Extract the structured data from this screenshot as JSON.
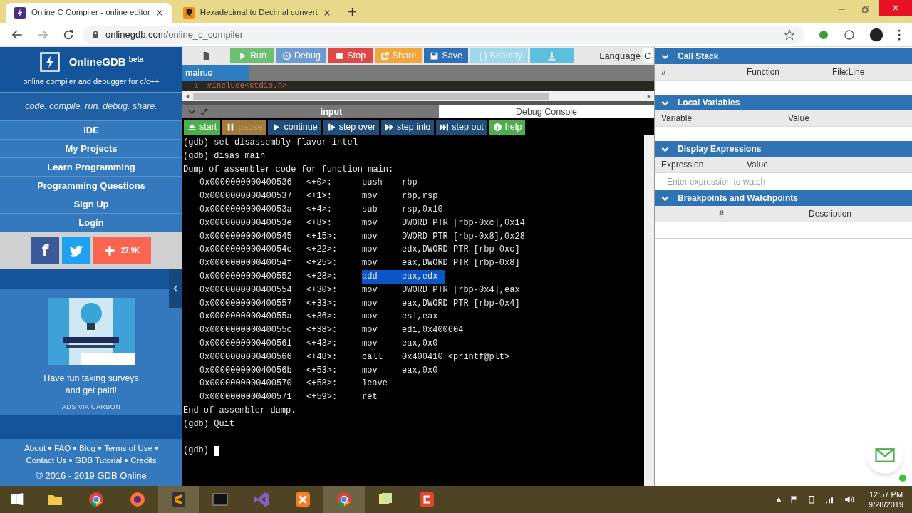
{
  "browser": {
    "tabs": [
      {
        "title": "Online C Compiler - online editor",
        "selected": true,
        "kind": "gdb"
      },
      {
        "title": "Hexadecimal to Decimal convert",
        "selected": false,
        "kind": "r"
      }
    ],
    "url_host": "onlinegdb.com",
    "url_path": "/online_c_compiler"
  },
  "sidebar": {
    "brand": "OnlineGDB",
    "brand_sup": "beta",
    "subtitle": "online compiler and debugger for c/c++",
    "tagline": "code. compile. run. debug. share.",
    "nav": [
      "IDE",
      "My Projects",
      "Learn Programming",
      "Programming Questions",
      "Sign Up",
      "Login"
    ],
    "share_count": "27.9K",
    "facebook_label": "f",
    "ad": {
      "text": "Have fun taking surveys and get paid!",
      "via": "ADS VIA CARBON"
    },
    "footer_links": [
      "About",
      "FAQ",
      "Blog",
      "Terms of Use",
      "Contact Us",
      "GDB Tutorial",
      "Credits"
    ],
    "copyright": "© 2016 - 2019 GDB Online"
  },
  "toolbar": [
    {
      "kind": "new",
      "color": "#e8e8e8",
      "disabled": false
    },
    {
      "kind": "run",
      "label": "Run",
      "color": "#6fbf73",
      "disabled": false
    },
    {
      "kind": "debug",
      "label": "Debug",
      "color": "#6b9bd1",
      "disabled": false
    },
    {
      "kind": "stop",
      "label": "Stop",
      "color": "#e04848",
      "disabled": false
    },
    {
      "kind": "share",
      "label": "Share",
      "color": "#f4a63c",
      "disabled": false
    },
    {
      "kind": "save",
      "label": "Save",
      "color": "#2e6fba",
      "disabled": false
    },
    {
      "kind": "beautify",
      "label": "{ } Beautify",
      "color": "#9ed8ea",
      "disabled": true
    },
    {
      "kind": "download",
      "color": "#5bc0de",
      "disabled": false
    }
  ],
  "language": {
    "label": "Language",
    "value": "C"
  },
  "file_tab": "main.c",
  "editor": {
    "line_number": "1",
    "code": "#include<stdio.h>"
  },
  "panel_tabs": [
    {
      "label": "input",
      "selected": false
    },
    {
      "label": "Debug Console",
      "selected": true
    }
  ],
  "debug_buttons": [
    {
      "kind": "start",
      "label": "start",
      "color": "#4cae4c",
      "disabled": false
    },
    {
      "kind": "pause",
      "label": "pause",
      "color": "#a07a3a",
      "disabled": true
    },
    {
      "kind": "continue",
      "label": "continue",
      "color": "#1f4e7a",
      "disabled": false
    },
    {
      "kind": "step_over",
      "label": "step over",
      "color": "#1f4e7a",
      "disabled": false
    },
    {
      "kind": "step_into",
      "label": "step into",
      "color": "#1f4e7a",
      "disabled": false
    },
    {
      "kind": "step_out",
      "label": "step out",
      "color": "#1f4e7a",
      "disabled": false
    },
    {
      "kind": "help",
      "label": "help",
      "color": "#4cae4c",
      "disabled": false
    }
  ],
  "console": {
    "before": [
      "(gdb) set disassembly-flavor intel",
      "(gdb) disas main",
      "Dump of assembler code for function main:"
    ],
    "rows": [
      {
        "address": "0x0000000000400536",
        "offset": "<+0>:",
        "op": "push",
        "args": "rbp",
        "selected": false
      },
      {
        "address": "0x0000000000400537",
        "offset": "<+1>:",
        "op": "mov",
        "args": "rbp,rsp",
        "selected": false
      },
      {
        "address": "0x000000000040053a",
        "offset": "<+4>:",
        "op": "sub",
        "args": "rsp,0x10",
        "selected": false
      },
      {
        "address": "0x000000000040053e",
        "offset": "<+8>:",
        "op": "mov",
        "args": "DWORD PTR [rbp-0xc],0x14",
        "selected": false
      },
      {
        "address": "0x0000000000400545",
        "offset": "<+15>:",
        "op": "mov",
        "args": "DWORD PTR [rbp-0x8],0x28",
        "selected": false
      },
      {
        "address": "0x000000000040054c",
        "offset": "<+22>:",
        "op": "mov",
        "args": "edx,DWORD PTR [rbp-0xc]",
        "selected": false
      },
      {
        "address": "0x000000000040054f",
        "offset": "<+25>:",
        "op": "mov",
        "args": "eax,DWORD PTR [rbp-0x8]",
        "selected": false
      },
      {
        "address": "0x0000000000400552",
        "offset": "<+28>:",
        "op": "add",
        "args": "eax,edx",
        "selected": true
      },
      {
        "address": "0x0000000000400554",
        "offset": "<+30>:",
        "op": "mov",
        "args": "DWORD PTR [rbp-0x4],eax",
        "selected": false
      },
      {
        "address": "0x0000000000400557",
        "offset": "<+33>:",
        "op": "mov",
        "args": "eax,DWORD PTR [rbp-0x4]",
        "selected": false
      },
      {
        "address": "0x000000000040055a",
        "offset": "<+36>:",
        "op": "mov",
        "args": "esi,eax",
        "selected": false
      },
      {
        "address": "0x000000000040055c",
        "offset": "<+38>:",
        "op": "mov",
        "args": "edi,0x400604",
        "selected": false
      },
      {
        "address": "0x0000000000400561",
        "offset": "<+43>:",
        "op": "mov",
        "args": "eax,0x0",
        "selected": false
      },
      {
        "address": "0x0000000000400566",
        "offset": "<+48>:",
        "op": "call",
        "args": "0x400410 <printf@plt>",
        "selected": false
      },
      {
        "address": "0x000000000040056b",
        "offset": "<+53>:",
        "op": "mov",
        "args": "eax,0x0",
        "selected": false
      },
      {
        "address": "0x0000000000400570",
        "offset": "<+58>:",
        "op": "leave",
        "selected": false
      },
      {
        "address": "0x0000000000400571",
        "offset": "<+59>:",
        "op": "ret",
        "selected": false
      }
    ],
    "after": [
      "End of assembler dump.",
      "(gdb) Quit"
    ],
    "prompt": "(gdb)"
  },
  "debug_panels": [
    {
      "title": "Call Stack",
      "expanded": true,
      "columns": [
        "#",
        "Function",
        "File:Line"
      ]
    },
    {
      "title": "Local Variables",
      "expanded": true,
      "columns": [
        "Variable",
        "Value"
      ]
    },
    {
      "title": "Display Expressions",
      "expanded": true,
      "columns": [
        "Expression",
        "Value"
      ],
      "placeholder": "Enter expression to watch"
    },
    {
      "title": "Breakpoints and Watchpoints",
      "expanded": true,
      "columns": [
        "#",
        "Description"
      ]
    }
  ],
  "taskbar": {
    "time": "12:57 PM",
    "date": "9/28/2019"
  }
}
